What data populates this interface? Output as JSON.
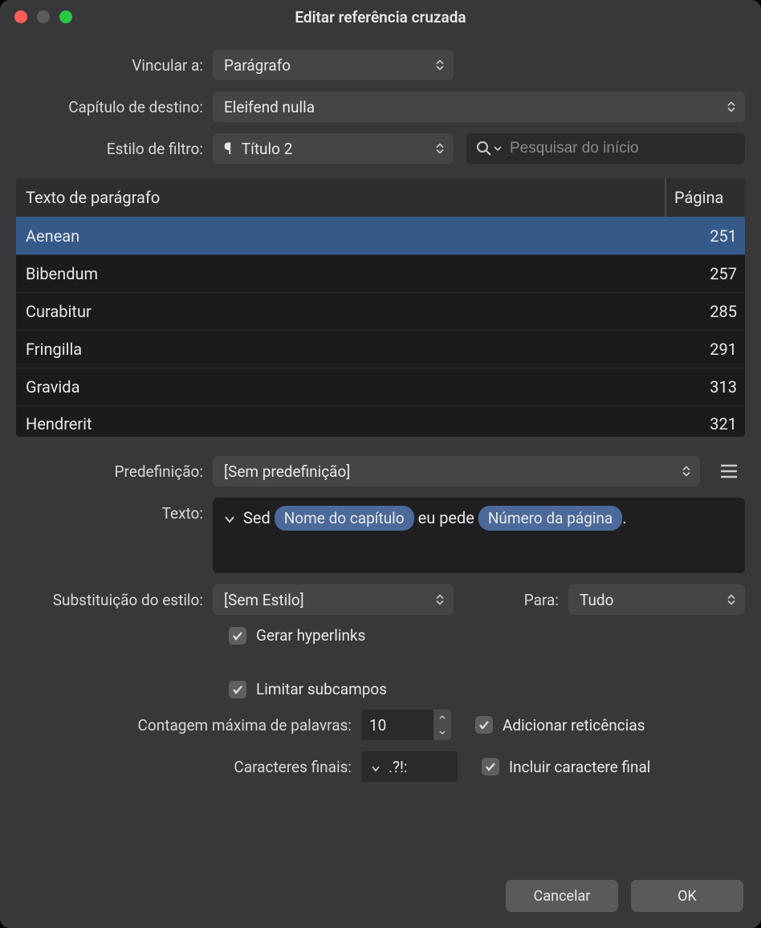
{
  "window": {
    "title": "Editar referência cruzada"
  },
  "labels": {
    "link_to": "Vincular a:",
    "dest_chapter": "Capítulo de destino:",
    "filter_style": "Estilo de filtro:",
    "preset": "Predefinição:",
    "text": "Texto:",
    "style_override": "Substituição do estilo:",
    "para": "Para:",
    "gen_hyperlinks": "Gerar hyperlinks",
    "limit_subfields": "Limitar subcampos",
    "max_words": "Contagem máxima de palavras:",
    "add_ellipsis": "Adicionar reticências",
    "final_chars": "Caracteres finais:",
    "include_final": "Incluir caractere final"
  },
  "values": {
    "link_to": "Parágrafo",
    "dest_chapter": "Eleifend nulla",
    "filter_style": "Título 2",
    "search_placeholder": "Pesquisar do início",
    "preset": "[Sem predefinição]",
    "style_override": "[Sem Estilo]",
    "para": "Tudo",
    "max_words": "10",
    "final_chars": ".?!:",
    "text_parts": {
      "t1": "Sed ",
      "token1": "Nome do capítulo",
      "t2": " eu pede ",
      "token2": "Número da página",
      "t3": "."
    }
  },
  "table": {
    "headers": {
      "text": "Texto de parágrafo",
      "page": "Página"
    },
    "rows": [
      {
        "text": "Aenean",
        "page": "251",
        "selected": true
      },
      {
        "text": "Bibendum",
        "page": "257",
        "selected": false
      },
      {
        "text": "Curabitur",
        "page": "285",
        "selected": false
      },
      {
        "text": "Fringilla",
        "page": "291",
        "selected": false
      },
      {
        "text": "Gravida",
        "page": "313",
        "selected": false
      },
      {
        "text": "Hendrerit",
        "page": "321",
        "selected": false
      }
    ]
  },
  "buttons": {
    "cancel": "Cancelar",
    "ok": "OK"
  }
}
